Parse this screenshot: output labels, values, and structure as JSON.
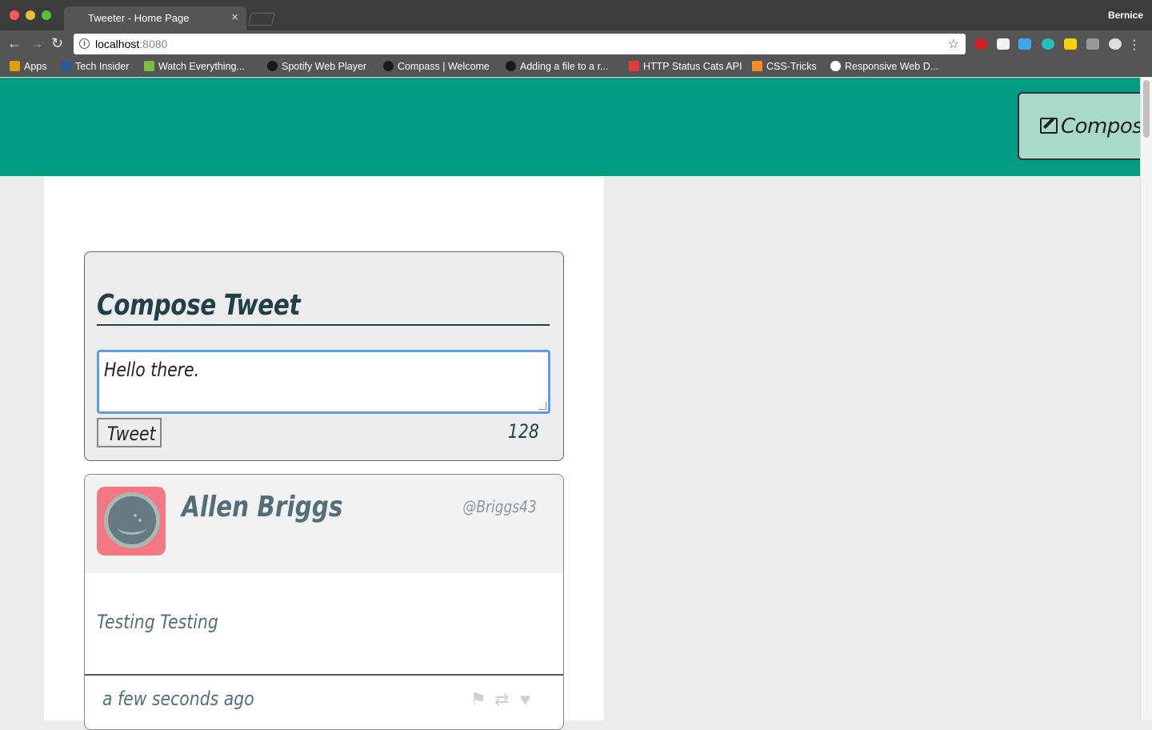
{
  "browser": {
    "tab_title": "Tweeter - Home Page",
    "tab_close": "×",
    "profile_name": "Bernice",
    "url_host": "localhost",
    "url_port": ":8080",
    "bookmarks": [
      {
        "label": "Apps",
        "icon": "apps-grid-icon",
        "color": "#e0a000"
      },
      {
        "label": "Tech Insider",
        "icon": "bi-icon",
        "color": "#2a5a9a"
      },
      {
        "label": "Watch Everything...",
        "icon": "play-icon",
        "color": "#7ac143"
      },
      {
        "label": "Spotify Web Player",
        "icon": "spotify-icon",
        "color": "#1a1a1a"
      },
      {
        "label": "Compass | Welcome",
        "icon": "compass-icon",
        "color": "#1a1a1a"
      },
      {
        "label": "Adding a file to a r...",
        "icon": "github-icon",
        "color": "#1a1a1a"
      },
      {
        "label": "HTTP Status Cats API",
        "icon": "cat-icon",
        "color": "#e23b3b"
      },
      {
        "label": "CSS-Tricks",
        "icon": "css-tricks-icon",
        "color": "#f28f20"
      },
      {
        "label": "Responsive Web D...",
        "icon": "responsive-icon",
        "color": "#ffffff"
      }
    ]
  },
  "header": {
    "compose_label": "Compose",
    "bg_color": "#009d85"
  },
  "new_tweet": {
    "title": "Compose Tweet",
    "textarea_value": "Hello there.",
    "submit_label": "Tweet",
    "counter": "128"
  },
  "tweet": {
    "name": "Allen Briggs",
    "handle": "@Briggs43",
    "content": "Testing Testing",
    "timestamp": "a few seconds ago",
    "avatar_color": "#f37884"
  }
}
